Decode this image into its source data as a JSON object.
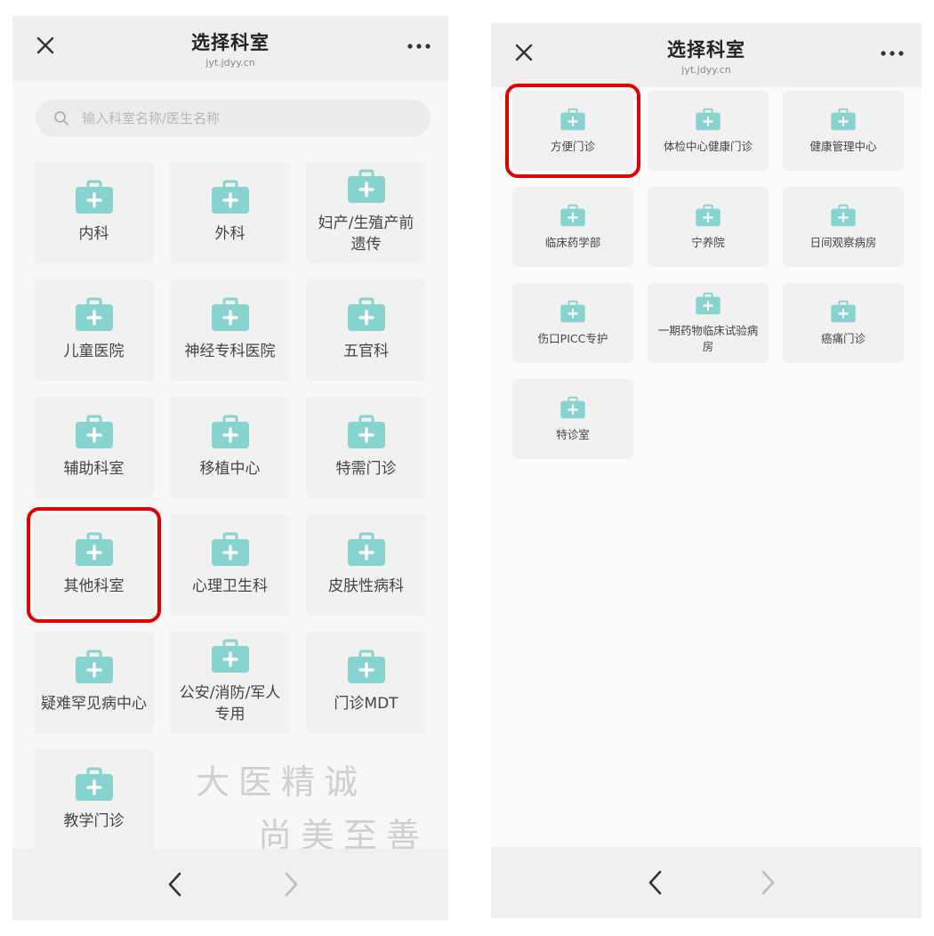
{
  "colors": {
    "accent_teal": "#86d3cf",
    "highlight_red": "#e00000"
  },
  "left": {
    "header": {
      "title": "选择科室",
      "domain": "jyt.jdyy.cn",
      "close_icon": "close-icon",
      "more_icon": "more-icon"
    },
    "search": {
      "placeholder": "输入科室名称/医生名称",
      "icon": "search-icon"
    },
    "departments": [
      "内科",
      "外科",
      "妇产/生殖产前遗传",
      "儿童医院",
      "神经专科医院",
      "五官科",
      "辅助科室",
      "移植中心",
      "特需门诊",
      "其他科室",
      "心理卫生科",
      "皮肤性病科",
      "疑难罕见病中心",
      "公安/消防/军人专用",
      "门诊MDT",
      "教学门诊"
    ],
    "highlighted_index": 9,
    "watermark": {
      "line1": "大医精诚",
      "line2": "尚美至善"
    }
  },
  "right": {
    "header": {
      "title": "选择科室",
      "domain": "jyt.jdyy.cn",
      "close_icon": "close-icon",
      "more_icon": "more-icon"
    },
    "departments": [
      "方便门诊",
      "体检中心健康门诊",
      "健康管理中心",
      "临床药学部",
      "宁养院",
      "日间观察病房",
      "伤口PICC专护",
      "一期药物临床试验病房",
      "癌痛门诊",
      "特诊室"
    ],
    "highlighted_index": 0
  },
  "bottom_nav": {
    "back_icon": "chevron-left-icon",
    "forward_icon": "chevron-right-icon"
  }
}
